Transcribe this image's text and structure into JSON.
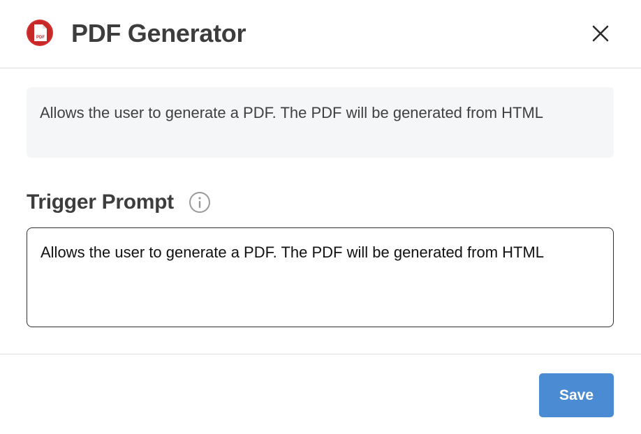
{
  "header": {
    "app_icon": "pdf-document-icon",
    "app_icon_text": "PDF",
    "title": "PDF Generator",
    "close_icon": "close-icon"
  },
  "description": {
    "text": "Allows the user to generate a PDF. The PDF will be generated from HTML"
  },
  "trigger_prompt": {
    "label": "Trigger Prompt",
    "info_icon": "info-icon",
    "value": "Allows the user to generate a PDF. The PDF will be generated from HTML"
  },
  "footer": {
    "save_label": "Save"
  },
  "colors": {
    "accent": "#4a8bd4",
    "pdf_red": "#d32f2f",
    "description_bg": "#f5f6f8",
    "divider": "#dcdde0"
  }
}
